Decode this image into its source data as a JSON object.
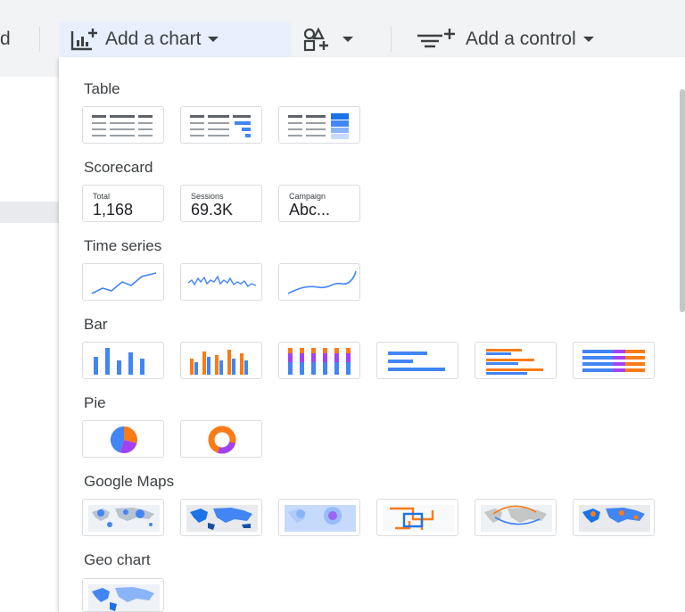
{
  "toolbar": {
    "prev_fragment": "d",
    "add_chart_label": "Add a chart",
    "add_control_label": "Add a control"
  },
  "menu": {
    "sections": {
      "table": "Table",
      "scorecard": "Scorecard",
      "time_series": "Time series",
      "bar": "Bar",
      "pie": "Pie",
      "google_maps": "Google Maps",
      "geo_chart": "Geo chart"
    },
    "scorecards": [
      {
        "label": "Total",
        "value": "1,168"
      },
      {
        "label": "Sessions",
        "value": "69.3K"
      },
      {
        "label": "Campaign",
        "value": "Abc..."
      }
    ]
  },
  "colors": {
    "blue": "#4285f4",
    "orange": "#fa7b17",
    "purple": "#a142f4",
    "highlight": "#e8f0fe"
  },
  "icons": [
    "chart-add-icon",
    "community-viz-icon",
    "control-add-icon",
    "caret-down-icon"
  ]
}
